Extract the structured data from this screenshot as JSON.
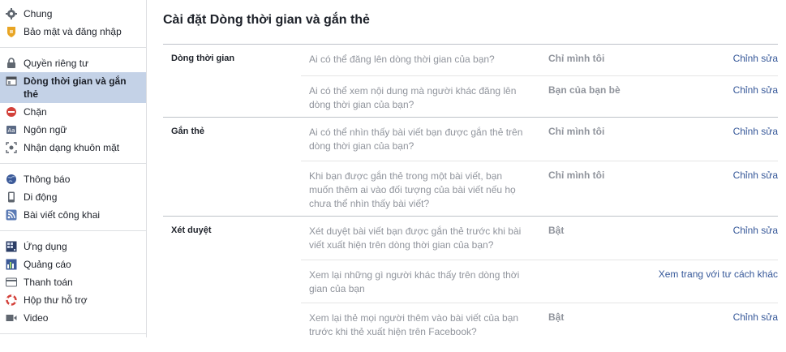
{
  "sidebar": {
    "groups": [
      [
        {
          "label": "Chung",
          "icon": "gear-icon"
        },
        {
          "label": "Bảo mật và đăng nhập",
          "icon": "badge-icon"
        }
      ],
      [
        {
          "label": "Quyền riêng tư",
          "icon": "lock-icon"
        },
        {
          "label": "Dòng thời gian và gắn thẻ",
          "icon": "timeline-icon",
          "active": true
        },
        {
          "label": "Chặn",
          "icon": "block-icon"
        },
        {
          "label": "Ngôn ngữ",
          "icon": "language-icon"
        },
        {
          "label": "Nhận dạng khuôn mặt",
          "icon": "face-icon"
        }
      ],
      [
        {
          "label": "Thông báo",
          "icon": "globe-icon"
        },
        {
          "label": "Di động",
          "icon": "mobile-icon"
        },
        {
          "label": "Bài viết công khai",
          "icon": "rss-icon"
        }
      ],
      [
        {
          "label": "Ứng dụng",
          "icon": "apps-icon"
        },
        {
          "label": "Quảng cáo",
          "icon": "ads-icon"
        },
        {
          "label": "Thanh toán",
          "icon": "card-icon"
        },
        {
          "label": "Hộp thư hỗ trợ",
          "icon": "lifebuoy-icon"
        },
        {
          "label": "Video",
          "icon": "video-icon"
        }
      ]
    ]
  },
  "page": {
    "title": "Cài đặt Dòng thời gian và gắn thẻ",
    "sections": [
      {
        "label": "Dòng thời gian",
        "rows": [
          {
            "question": "Ai có thể đăng lên dòng thời gian của bạn?",
            "value": "Chỉ mình tôi",
            "action": "Chỉnh sửa"
          },
          {
            "question": "Ai có thể xem nội dung mà người khác đăng lên dòng thời gian của bạn?",
            "value": "Bạn của bạn bè",
            "action": "Chỉnh sửa"
          }
        ]
      },
      {
        "label": "Gắn thẻ",
        "rows": [
          {
            "question": "Ai có thể nhìn thấy bài viết bạn được gắn thẻ trên dòng thời gian của bạn?",
            "value": "Chỉ mình tôi",
            "action": "Chỉnh sửa"
          },
          {
            "question": "Khi bạn được gắn thẻ trong một bài viết, bạn muốn thêm ai vào đối tượng của bài viết nếu họ chưa thể nhìn thấy bài viết?",
            "value": "Chỉ mình tôi",
            "action": "Chỉnh sửa"
          }
        ]
      },
      {
        "label": "Xét duyệt",
        "rows": [
          {
            "question": "Xét duyệt bài viết bạn được gắn thẻ trước khi bài viết xuất hiện trên dòng thời gian của bạn?",
            "value": "Bật",
            "action": "Chỉnh sửa"
          },
          {
            "question": "Xem lại những gì người khác thấy trên dòng thời gian của bạn",
            "value": "",
            "action": "Xem trang với tư cách khác"
          },
          {
            "question": "Xem lại thẻ mọi người thêm vào bài viết của bạn trước khi thẻ xuất hiện trên Facebook?",
            "value": "Bật",
            "action": "Chỉnh sửa"
          }
        ]
      }
    ]
  }
}
